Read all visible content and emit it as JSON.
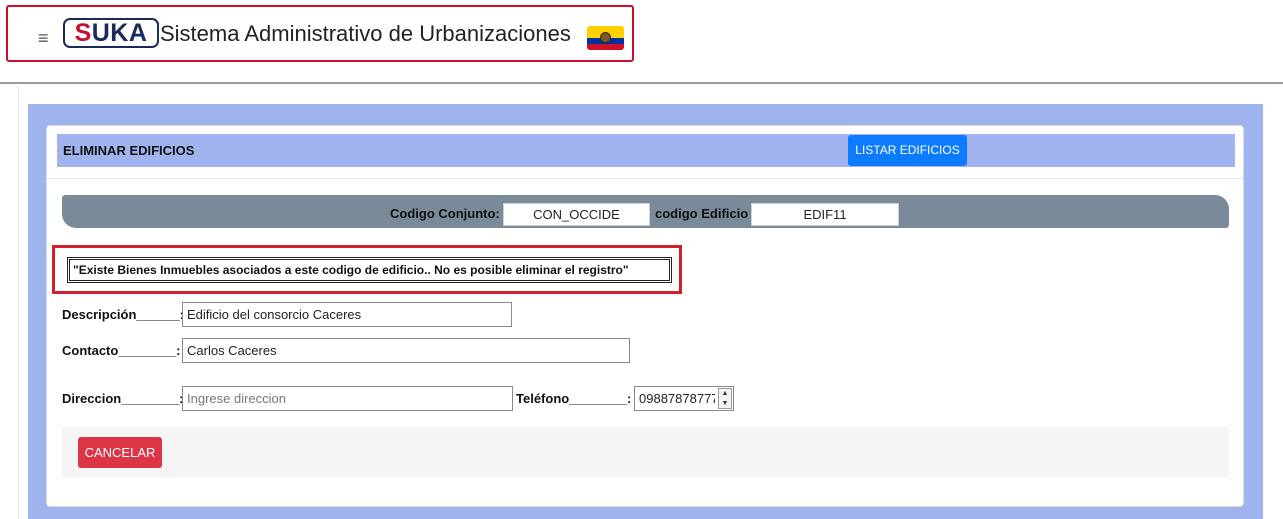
{
  "app": {
    "logo_text_s": "S",
    "logo_text_rest": "UKA",
    "title": "Sistema Administrativo de Urbanizaciones",
    "menu_icon": "≡",
    "flag_icon": "ecuador-flag-icon"
  },
  "header": {
    "title": "ELIMINAR EDIFICIOS",
    "list_button": "LISTAR EDIFICIOS"
  },
  "codes": {
    "conjunto_label": "Codigo Conjunto:",
    "conjunto_value": "CON_OCCIDE",
    "edificio_label": "codigo Edificio",
    "edificio_value": "EDIF11"
  },
  "error": {
    "message": "\"Existe Bienes Inmuebles asociados a este codigo de edificio.. No es posible eliminar el registro\""
  },
  "form": {
    "descripcion_label": "Descripción______:",
    "descripcion_value": "Edificio del consorcio Caceres",
    "contacto_label": "Contacto________:",
    "contacto_value": "Carlos Caceres",
    "direccion_label": "Direccion________:",
    "direccion_value": "",
    "direccion_placeholder": "Ingrese direccion",
    "telefono_label": "Teléfono________:",
    "telefono_value": "09887878777",
    "stepper_up": "▲",
    "stepper_down": "▼"
  },
  "actions": {
    "cancel_label": "CANCELAR"
  },
  "colors": {
    "accent_blue": "#0d7bff",
    "danger_red": "#dc3545",
    "panel_blue": "#9fb3ee",
    "code_bar_gray": "#7a8a99"
  }
}
